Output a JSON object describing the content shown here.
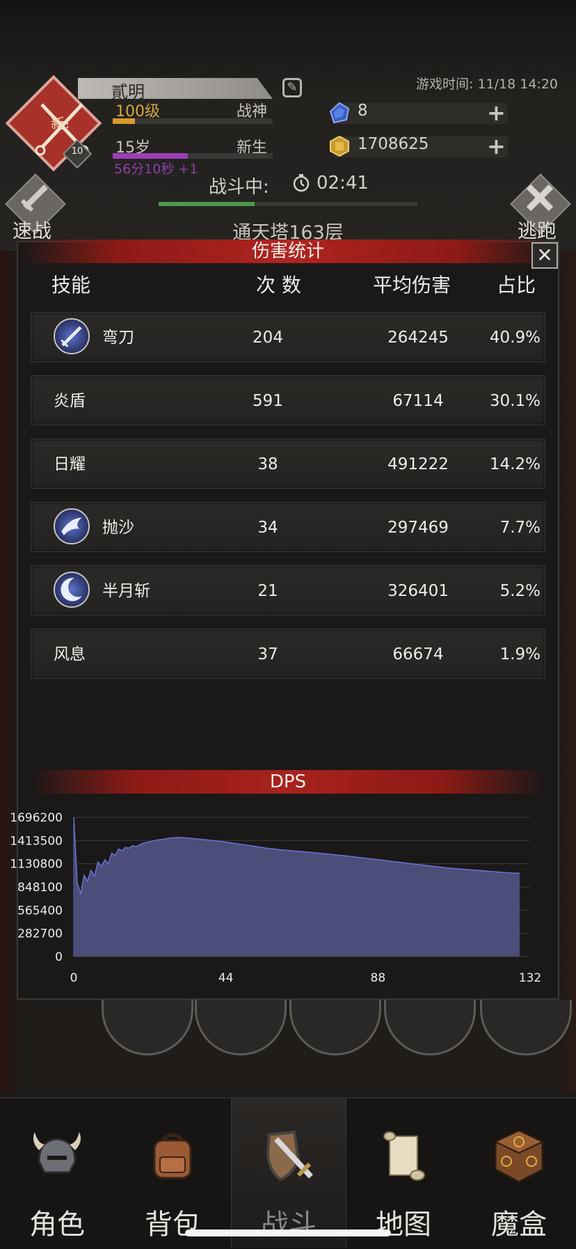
{
  "header": {
    "name": "貳明",
    "level": "100级",
    "title1": "战神",
    "age": "15岁",
    "title2": "新生",
    "age_timer": "56分10秒 +1",
    "game_time": "游戏时间: 11/18 14:20",
    "avatar_badge": "新!",
    "avatar_level": "10",
    "level_progress": 0.14,
    "age_progress": 0.47,
    "gems": "8",
    "gold": "1708625",
    "battle_state": "战斗中:",
    "battle_time": "02:41",
    "hp_progress": 0.37,
    "speed_battle": "速战",
    "escape": "逃跑",
    "floor": "通天塔163层"
  },
  "popup": {
    "title": "伤害统计",
    "close": "✕",
    "columns": [
      "技能",
      "次 数",
      "平均伤害",
      "占比"
    ],
    "rows": [
      {
        "skill": "弯刀",
        "count": "204",
        "avg": "264245",
        "pct": "40.9%",
        "icon": "sword-icon"
      },
      {
        "skill": "炎盾",
        "count": "591",
        "avg": "67114",
        "pct": "30.1%",
        "icon": ""
      },
      {
        "skill": "日耀",
        "count": "38",
        "avg": "491222",
        "pct": "14.2%",
        "icon": ""
      },
      {
        "skill": "抛沙",
        "count": "34",
        "avg": "297469",
        "pct": "7.7%",
        "icon": "sand-icon"
      },
      {
        "skill": "半月斩",
        "count": "21",
        "avg": "326401",
        "pct": "5.2%",
        "icon": "crescent-icon"
      },
      {
        "skill": "风息",
        "count": "37",
        "avg": "66674",
        "pct": "1.9%",
        "icon": ""
      }
    ]
  },
  "chart_data": {
    "type": "area",
    "title": "DPS",
    "xlabel": "",
    "ylabel": "",
    "x_ticks": [
      0,
      44,
      88,
      132
    ],
    "y_ticks": [
      0,
      282700,
      565400,
      848100,
      1130800,
      1413500,
      1696200
    ],
    "xlim": [
      0,
      132
    ],
    "ylim": [
      0,
      1696200
    ],
    "grid": true,
    "fill_color": "#4a4e78",
    "line_color": "#6b74d8",
    "x": [
      0,
      1,
      2,
      3,
      4,
      5,
      6,
      7,
      8,
      9,
      10,
      11,
      12,
      13,
      14,
      15,
      16,
      17,
      18,
      19,
      20,
      22,
      24,
      26,
      28,
      30,
      32,
      34,
      36,
      40,
      44,
      48,
      52,
      56,
      60,
      66,
      72,
      78,
      84,
      90,
      96,
      102,
      108,
      114,
      120,
      126,
      129
    ],
    "y": [
      1696200,
      900000,
      760000,
      990000,
      920000,
      1050000,
      980000,
      1150000,
      1100000,
      1180000,
      1130000,
      1260000,
      1230000,
      1310000,
      1290000,
      1330000,
      1320000,
      1350000,
      1340000,
      1360000,
      1380000,
      1400000,
      1420000,
      1430000,
      1445000,
      1450000,
      1448000,
      1440000,
      1432000,
      1415000,
      1395000,
      1370000,
      1345000,
      1320000,
      1300000,
      1280000,
      1255000,
      1230000,
      1200000,
      1170000,
      1140000,
      1110000,
      1080000,
      1060000,
      1040000,
      1020000,
      1015000
    ]
  },
  "nav": [
    {
      "label": "角色",
      "icon": "helmet-icon"
    },
    {
      "label": "背包",
      "icon": "backpack-icon"
    },
    {
      "label": "战斗",
      "icon": "sword-shield-icon"
    },
    {
      "label": "地图",
      "icon": "scroll-map-icon"
    },
    {
      "label": "魔盒",
      "icon": "magic-box-icon"
    }
  ]
}
